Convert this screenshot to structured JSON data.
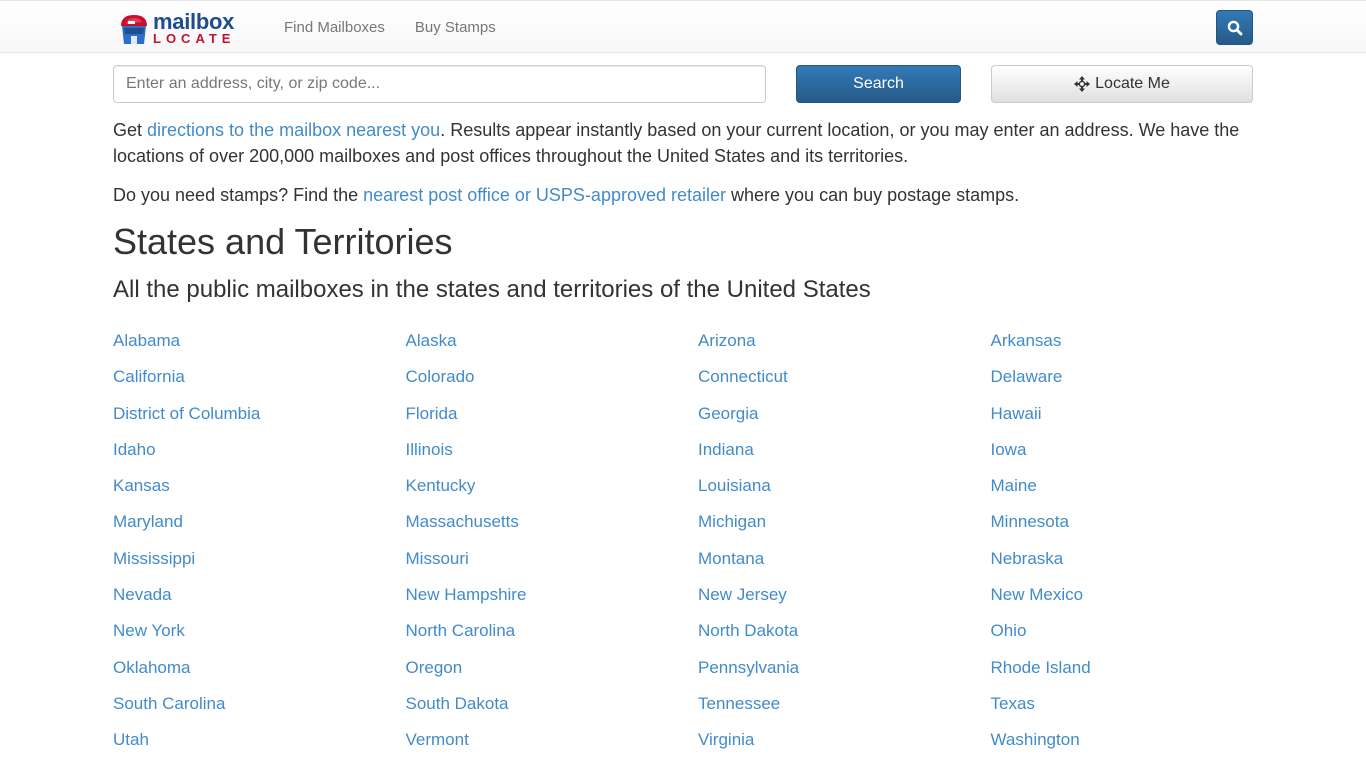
{
  "navbar": {
    "logo": {
      "word1": "mailbox",
      "word2": "LOCATE"
    },
    "links": [
      "Find Mailboxes",
      "Buy Stamps"
    ],
    "search_icon": "search-icon"
  },
  "search": {
    "placeholder": "Enter an address, city, or zip code...",
    "value": "",
    "search_button": "Search",
    "locate_button": "Locate Me",
    "locate_icon": "crosshair-move-icon"
  },
  "intro": {
    "prefix": "Get ",
    "link": "directions to the mailbox nearest you",
    "suffix": ". Results appear instantly based on your current location, or you may enter an address. We have the locations of over 200,000 mailboxes and post offices throughout the United States and its territories."
  },
  "stamps": {
    "prefix": "Do you need stamps? Find the ",
    "link": "nearest post office or USPS-approved retailer",
    "suffix": " where you can buy postage stamps."
  },
  "heading": "States and Territories",
  "subheading": "All the public mailboxes in the states and territories of the United States",
  "states": [
    "Alabama",
    "Alaska",
    "Arizona",
    "Arkansas",
    "California",
    "Colorado",
    "Connecticut",
    "Delaware",
    "District of Columbia",
    "Florida",
    "Georgia",
    "Hawaii",
    "Idaho",
    "Illinois",
    "Indiana",
    "Iowa",
    "Kansas",
    "Kentucky",
    "Louisiana",
    "Maine",
    "Maryland",
    "Massachusetts",
    "Michigan",
    "Minnesota",
    "Mississippi",
    "Missouri",
    "Montana",
    "Nebraska",
    "Nevada",
    "New Hampshire",
    "New Jersey",
    "New Mexico",
    "New York",
    "North Carolina",
    "North Dakota",
    "Ohio",
    "Oklahoma",
    "Oregon",
    "Pennsylvania",
    "Rhode Island",
    "South Carolina",
    "South Dakota",
    "Tennessee",
    "Texas",
    "Utah",
    "Vermont",
    "Virginia",
    "Washington"
  ],
  "colors": {
    "link": "#428bca",
    "primary": "#337ab7",
    "logo_blue": "#1f4e8c",
    "logo_red": "#c8102e",
    "text": "#333333"
  }
}
